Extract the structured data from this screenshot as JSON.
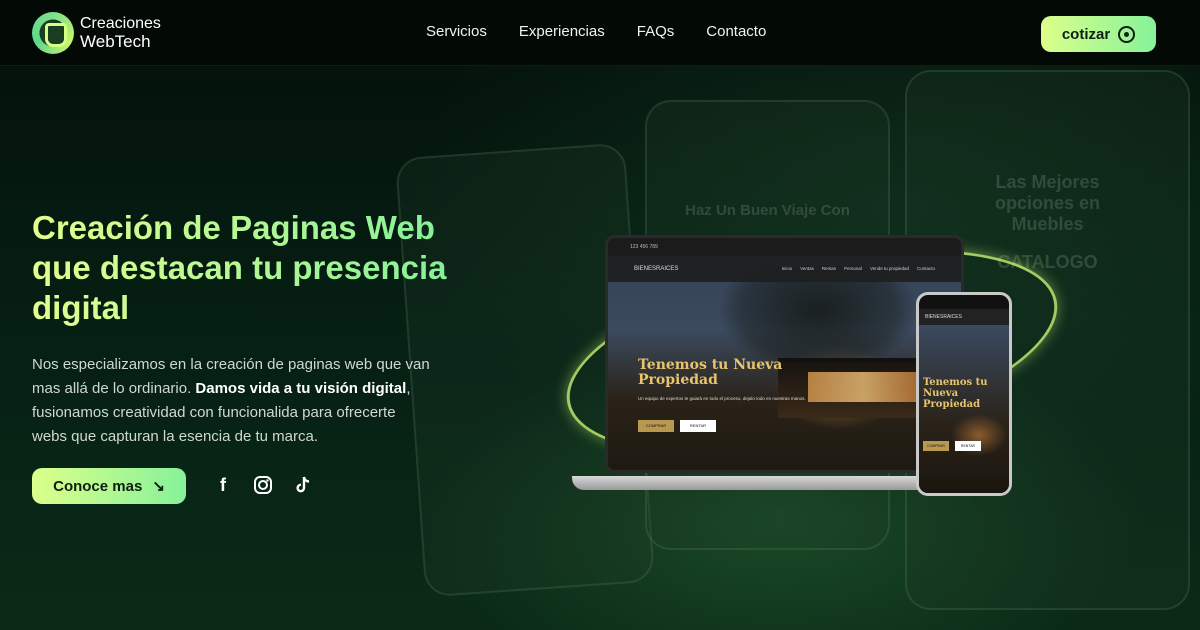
{
  "brand": {
    "line1": "Creaciones",
    "line2": "WebTech"
  },
  "nav": {
    "items": [
      "Servicios",
      "Experiencias",
      "FAQs",
      "Contacto"
    ]
  },
  "header_cta": {
    "label": "cotizar",
    "icon": "whatsapp-icon"
  },
  "hero": {
    "title": "Creación de Paginas Web que destacan tu presencia digital",
    "desc_part1": "Nos especializamos en la creación de paginas web que van mas allá de lo ordinario. ",
    "desc_strong": "Damos vida a tu visión digital",
    "desc_part2": ", fusionamos creatividad con funcionalida para ofrecerte webs que capturan la esencia de tu marca.",
    "button_label": "Conoce mas",
    "button_icon": "arrow-down-right-icon"
  },
  "socials": [
    "facebook-icon",
    "instagram-icon",
    "tiktok-icon"
  ],
  "mockup": {
    "phone_number": "123 456 789",
    "site_brand": "BIENESRAICES",
    "menu": [
      "Inicio",
      "Ventas",
      "Rentas",
      "Personal",
      "Vende tu propiedad",
      "Contacto"
    ],
    "headline": "Tenemos tu Nueva Propiedad",
    "subtext": "Un equipo de expertos te guiará en todo el proceso, dejalo todo en nuestras manos.",
    "btn_primary": "COMPRAR",
    "btn_secondary": "RENTAR"
  },
  "background_phones": {
    "text1": "Haz Un Buen Viaje Con",
    "text2": "Las Mejores opciones en Muebles",
    "text3": "CATALOGO"
  },
  "colors": {
    "accent_start": "#dcff8a",
    "accent_end": "#86f29a",
    "gold": "#e9c46a"
  }
}
